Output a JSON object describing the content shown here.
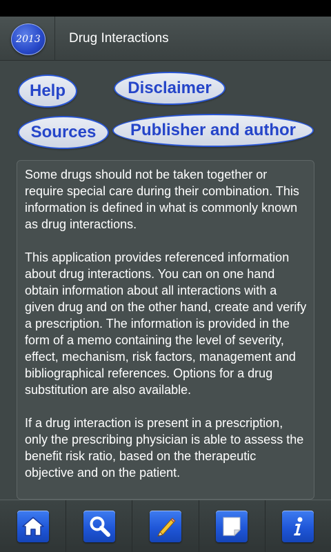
{
  "header": {
    "logo_text": "2013",
    "title": "Drug Interactions"
  },
  "buttons": {
    "help": "Help",
    "disclaimer": "Disclaimer",
    "sources": "Sources",
    "publisher": "Publisher and author"
  },
  "content": {
    "paragraphs": [
      "Some drugs should not be taken together or require special care during their combination. This information is defined in what is commonly known as drug interactions.",
      "This application provides referenced information about drug interactions. You can on one hand obtain information about all interactions with a given drug and on the other hand, create and verify a prescription. The information is provided in the form of a memo containing the level of severity, effect, mechanism, risk factors, management and bibliographical references. Options for a drug substitution are also available.",
      "If a drug interaction is present in a prescription, only the prescribing physician is able to assess the benefit risk ratio, based on the therapeutic objective and on the patient."
    ]
  },
  "nav": {
    "items": [
      {
        "icon": "home-icon"
      },
      {
        "icon": "search-icon"
      },
      {
        "icon": "pencil-icon"
      },
      {
        "icon": "note-icon"
      },
      {
        "icon": "info-icon"
      }
    ]
  },
  "colors": {
    "background": "#3f4747",
    "accent_blue": "#2545c9",
    "tile_blue": "#1f56d8"
  }
}
